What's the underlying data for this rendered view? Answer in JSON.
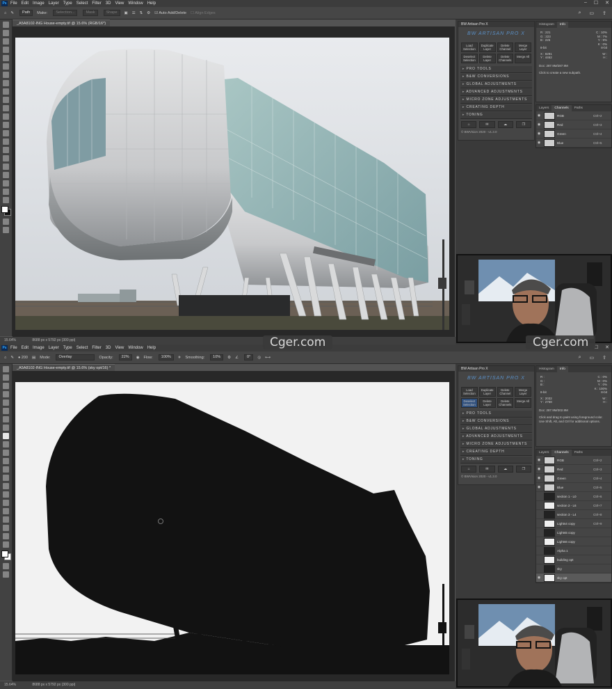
{
  "menu": {
    "app_badge": "Ps",
    "items": [
      "File",
      "Edit",
      "Image",
      "Layer",
      "Type",
      "Select",
      "Filter",
      "3D",
      "View",
      "Window",
      "Help"
    ]
  },
  "top": {
    "options": {
      "tool_mode": "Path",
      "make_label": "Make:",
      "selection_label": "Selection...",
      "mask_label": "Mask",
      "shape_label": "Shape",
      "auto_add_delete": "Auto Add/Delete",
      "align_edges": "Align Edges"
    },
    "tab": "_A5A8102-ING House-empty.tif @ 15.6% (RGB/16*)",
    "status": {
      "zoom": "15.64%",
      "doc_size": "8688 px x 5792 px (300 ppi)"
    },
    "info": {
      "tabs": [
        "Histogram",
        "Info"
      ],
      "r": "R :",
      "g": "G :",
      "b": "B :",
      "rv": "221",
      "gv": "223",
      "bv": "225",
      "c": "C :",
      "m": "M :",
      "y": "Y :",
      "k": "K :",
      "cv": "10%",
      "mv": "7%",
      "yv": "9%",
      "kv": "0%",
      "bit": "8-bit",
      "x": "X :",
      "yy": "Y :",
      "xv": "8291",
      "yyv": "4462",
      "w": "W :",
      "h": "H :",
      "doc": "Doc: 287.9M/287.9M",
      "msg": "Click to create a new subpath."
    },
    "channels": [
      {
        "name": "RGB",
        "shortcut": "Ctrl+2"
      },
      {
        "name": "Red",
        "shortcut": "Ctrl+3"
      },
      {
        "name": "Green",
        "shortcut": "Ctrl+4"
      },
      {
        "name": "Blue",
        "shortcut": "Ctrl+5"
      }
    ]
  },
  "bottom": {
    "options": {
      "mode_label": "Mode:",
      "mode_value": "Overlay",
      "opacity_label": "Opacity:",
      "opacity_value": "22%",
      "flow_label": "Flow:",
      "flow_value": "100%",
      "smoothing_label": "Smoothing:",
      "smoothing_value": "10%",
      "brush_size": "200",
      "angle": "0°"
    },
    "tab": "_A5A8102-ING House-empty.tif @ 15.6% (sky opt/16) *",
    "status": {
      "zoom": "15.64%",
      "doc_size": "8688 px x 5792 px (300 ppi)"
    },
    "info": {
      "tabs": [
        "Histogram",
        "Info"
      ],
      "cv": "0%",
      "mv": "0%",
      "yv": "0%",
      "kv": "100%",
      "bit": "8-bit",
      "xv": "2032",
      "yyv": "2768",
      "doc": "Doc: 287.9M/302.9M",
      "msg": "Click and drag to paint using foreground color. Use Shift, Alt, and Ctrl for additional options."
    },
    "channels": [
      {
        "name": "RGB",
        "shortcut": "Ctrl+2"
      },
      {
        "name": "Red",
        "shortcut": "Ctrl+3"
      },
      {
        "name": "Green",
        "shortcut": "Ctrl+4"
      },
      {
        "name": "Blue",
        "shortcut": "Ctrl+5"
      },
      {
        "name": "section 1 - L0",
        "shortcut": "Ctrl+6"
      },
      {
        "name": "section 2 - L6",
        "shortcut": "Ctrl+7"
      },
      {
        "name": "section 3 - L4",
        "shortcut": "Ctrl+8"
      },
      {
        "name": "Lights4 copy",
        "shortcut": "Ctrl+9"
      },
      {
        "name": "Lights5 copy",
        "shortcut": ""
      },
      {
        "name": "Lights6 copy",
        "shortcut": ""
      },
      {
        "name": "Alpha 1",
        "shortcut": ""
      },
      {
        "name": "building opt",
        "shortcut": ""
      },
      {
        "name": "sky",
        "shortcut": ""
      },
      {
        "name": "sky opt",
        "shortcut": ""
      }
    ]
  },
  "bwpanel": {
    "title": "BW Artisan Pro X",
    "logo": "BW ARTISAN PRO X",
    "buttons": [
      "Load Selection",
      "Duplicate Layer",
      "Delete Channel",
      "Merge Layer",
      "Deselect Selection",
      "Delete Layer",
      "Delete Channels",
      "Merge All"
    ],
    "sections": [
      "PRO TOOLS",
      "B&W CONVERSIONS",
      "GLOBAL ADJUSTMENTS",
      "ADVANCED ADJUSTMENTS",
      "MICRO ZONE ADJUSTMENTS",
      "CREATING DEPTH",
      "TONING"
    ],
    "version": "© BWVision 2020 - v1.3.0"
  },
  "panels_tabs": [
    "Layers",
    "Channels",
    "Paths"
  ],
  "watermark": "Cger.com",
  "colors": {
    "accent": "#2f4f7c",
    "panel": "#454545",
    "workspace": "#535353"
  }
}
